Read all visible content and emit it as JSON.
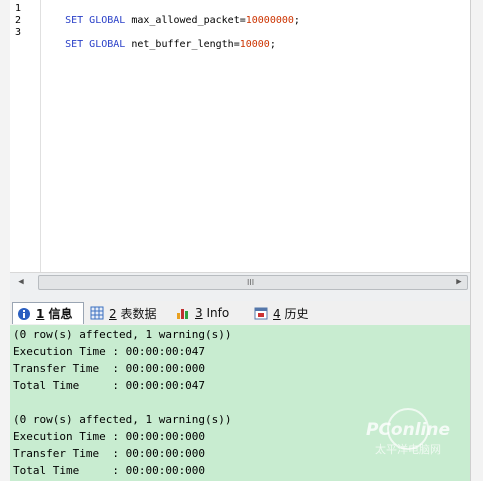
{
  "editor": {
    "lines": [
      {
        "num": "1",
        "kw": "SET GLOBAL",
        "name": "max_allowed_packet=",
        "value": "10000000",
        "end": ";"
      },
      {
        "num": "2",
        "kw": "",
        "name": "",
        "value": "",
        "end": ""
      },
      {
        "num": "3",
        "kw": "SET GLOBAL",
        "name": "net_buffer_length=",
        "value": "10000",
        "end": ";"
      }
    ]
  },
  "scrollbar": {
    "left_arrow": "◀",
    "right_arrow": "▶",
    "grip": "III"
  },
  "tabs": [
    {
      "key": "1",
      "label": "信息",
      "icon": "info-icon"
    },
    {
      "key": "2",
      "label": "表数据",
      "icon": "table-data-icon"
    },
    {
      "key": "3",
      "label": "Info",
      "icon": "info-chart-icon"
    },
    {
      "key": "4",
      "label": "历史",
      "icon": "history-icon"
    }
  ],
  "results": {
    "lines": [
      "(0 row(s) affected, 1 warning(s))",
      "Execution Time : 00:00:00:047",
      "Transfer Time  : 00:00:00:000",
      "Total Time     : 00:00:00:047",
      "",
      "(0 row(s) affected, 1 warning(s))",
      "Execution Time : 00:00:00:000",
      "Transfer Time  : 00:00:00:000",
      "Total Time     : 00:00:00:000"
    ]
  },
  "watermark": {
    "brand": "PConline",
    "sub": "太平洋电脑网"
  },
  "colors": {
    "keyword": "#2a40c8",
    "number": "#cc3300",
    "results_bg": "#c8ecd0"
  }
}
